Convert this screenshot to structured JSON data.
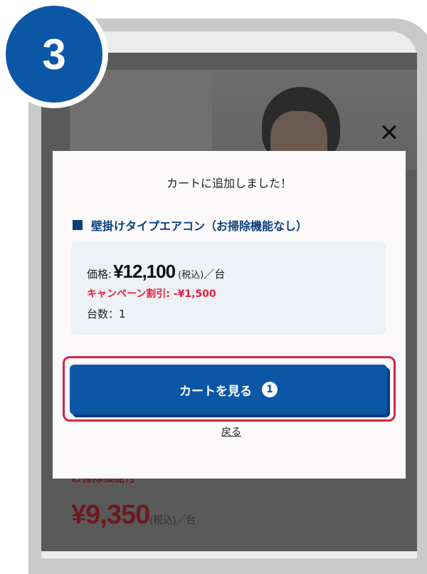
{
  "step": {
    "number": "3"
  },
  "background_page": {
    "campaign_text": "お掃除機能付",
    "price_amount": "¥9,350",
    "price_suffix": "(税込)／台"
  },
  "modal": {
    "close_icon": "close-icon",
    "title": "カートに追加しました！",
    "product_name": "壁掛けタイプエアコン（お掃除機能なし）",
    "price_label": "価格:",
    "price_amount": "¥12,100",
    "price_tax": "(税込)",
    "price_unit": "／台",
    "campaign_discount": "キャンペーン割引: -¥1,500",
    "quantity": "台数：1",
    "cart_button_label": "カートを見る",
    "cart_count": "1",
    "back_label": "戻る"
  },
  "colors": {
    "brand_blue": "#0b57a6",
    "highlight_red": "#d8234a",
    "discount_red": "#e2213f"
  }
}
